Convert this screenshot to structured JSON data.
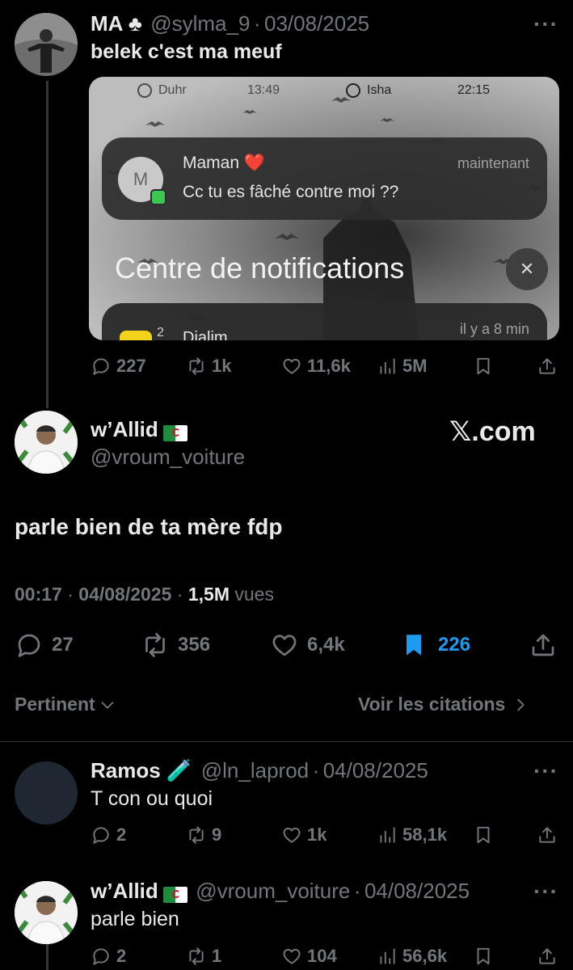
{
  "tweet1": {
    "name": "MA ♣",
    "handle": "@sylma_9",
    "date": "03/08/2025",
    "text": "belek c'est ma meuf",
    "actions": {
      "replies": "227",
      "reposts": "1k",
      "likes": "11,6k",
      "views": "5M"
    },
    "embed": {
      "status_left": "Duhr",
      "status_time1": "13:49",
      "status_right": "Isha",
      "status_time2": "22:15",
      "notif_avatar": "M",
      "notif_sender": "Maman ❤️",
      "notif_time": "maintenant",
      "notif_message": "Cc tu es fâché contre moi ??",
      "center_title": "Centre de notifications",
      "close_glyph": "✕",
      "next_app": "Djalim",
      "next_badge": "2",
      "next_time": "il y a 8 min"
    }
  },
  "main": {
    "name": "w’Allid",
    "handle": "@vroum_voiture",
    "watermark": "𝕏.com",
    "text": "parle bien de ta mère fdp",
    "time": "00:17",
    "date": "04/08/2025",
    "views": "1,5M",
    "views_label": "vues",
    "actions": {
      "replies": "27",
      "reposts": "356",
      "likes": "6,4k",
      "bookmarks": "226"
    },
    "sort_label": "Pertinent",
    "quotes_label": "Voir les citations"
  },
  "reply1": {
    "name": "Ramos 🧪",
    "handle": "@ln_laprod",
    "date": "04/08/2025",
    "text": "T con ou quoi",
    "actions": {
      "replies": "2",
      "reposts": "9",
      "likes": "1k",
      "views": "58,1k"
    }
  },
  "reply2": {
    "name": "w’Allid",
    "handle": "@vroum_voiture",
    "date": "04/08/2025",
    "text": "parle bien",
    "actions": {
      "replies": "2",
      "reposts": "1",
      "likes": "104",
      "views": "56,6k"
    }
  },
  "colors": {
    "accent": "#1d9bf0",
    "muted": "#71767b",
    "background": "#000000"
  }
}
